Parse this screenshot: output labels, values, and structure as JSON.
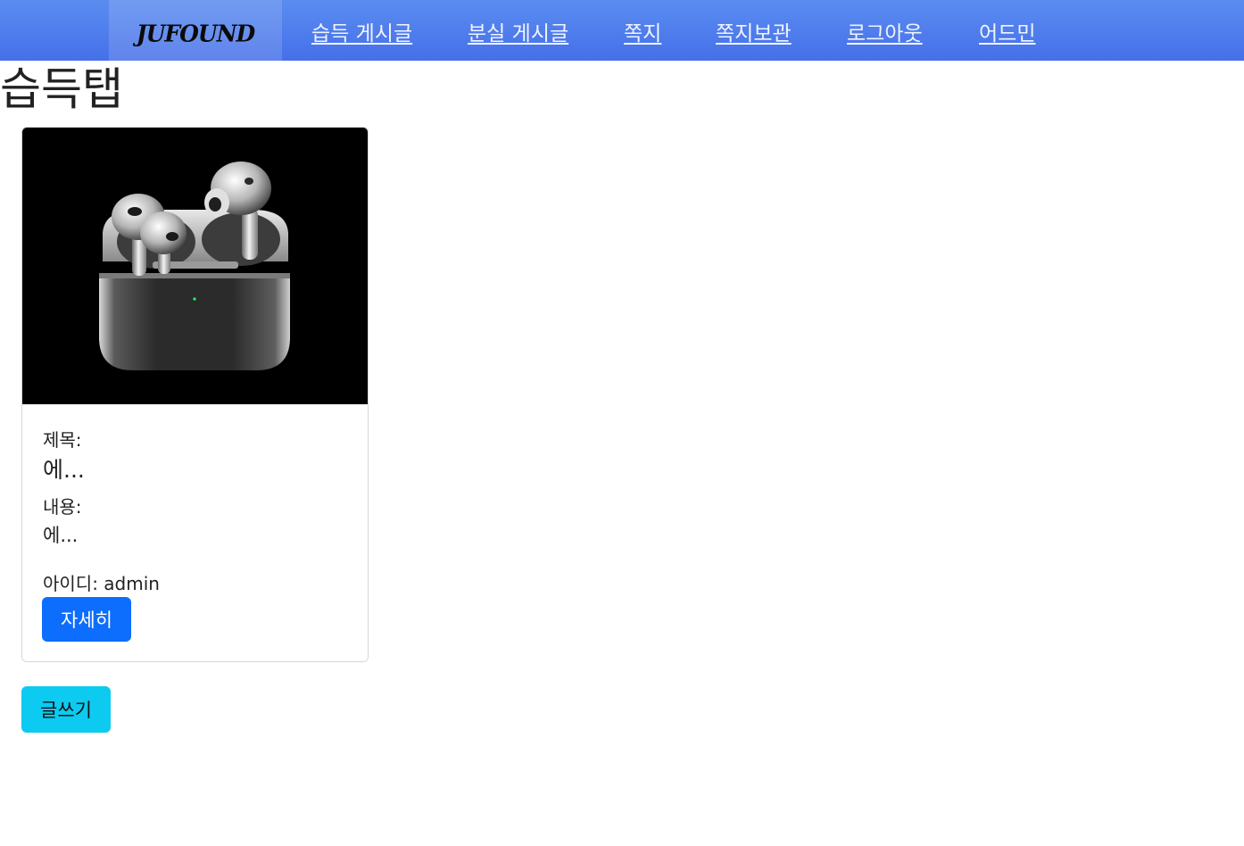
{
  "navbar": {
    "brand": "JUFOUND",
    "links": [
      {
        "label": "습득 게시글"
      },
      {
        "label": "분실 게시글"
      },
      {
        "label": "쪽지"
      },
      {
        "label": "쪽지보관"
      },
      {
        "label": "로그아웃"
      },
      {
        "label": "어드민"
      }
    ]
  },
  "page": {
    "title": "습득탭"
  },
  "card": {
    "image_icon": "airpods-pro-photo",
    "title_label": "제목:",
    "title_value": "에...",
    "content_label": "내용:",
    "content_value": "에...",
    "id_text": "아이디: admin",
    "detail_button": "자세히"
  },
  "actions": {
    "write_button": "글쓰기"
  },
  "colors": {
    "navbar_gradient_top": "#5a8cf0",
    "navbar_gradient_bottom": "#4670e9",
    "primary_button": "#0d6efd",
    "info_button": "#0dcaf0"
  }
}
